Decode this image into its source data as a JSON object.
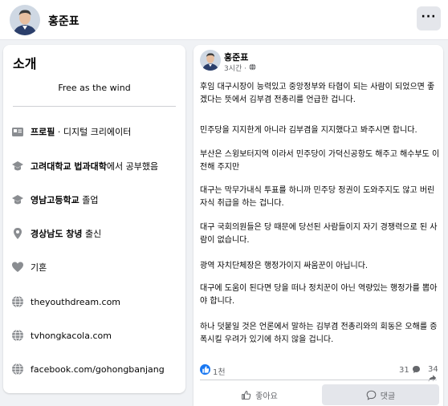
{
  "header": {
    "profile_name": "홍준표",
    "more_label": "···"
  },
  "intro": {
    "title": "소개",
    "bio": "Free as the wind",
    "items": [
      {
        "icon": "profile-card-icon",
        "bold": "프로필",
        "text": " · 디지털 크리에이터"
      },
      {
        "icon": "graduation-cap-icon",
        "bold": "고려대학교 법과대학",
        "text": "에서 공부했음"
      },
      {
        "icon": "graduation-cap-icon",
        "bold": "영남고등학교",
        "text": " 졸업"
      },
      {
        "icon": "location-pin-icon",
        "bold": "경상남도 창녕",
        "text": " 출신"
      },
      {
        "icon": "heart-icon",
        "bold": "",
        "text": "기혼"
      },
      {
        "icon": "globe-icon",
        "bold": "",
        "text": "theyouthdream.com"
      },
      {
        "icon": "globe-icon",
        "bold": "",
        "text": "tvhongkacola.com"
      },
      {
        "icon": "globe-icon",
        "bold": "",
        "text": "facebook.com/gohongbanjang"
      }
    ]
  },
  "post": {
    "author": "홍준표",
    "time": "3시간 ·",
    "paragraphs": [
      "후임 대구시장이 능력있고 중앙정부와 타협이 되는 사람이 되었으면 좋겠다는 뜻에서 김부겸 전총리를 언급한 겁니다.",
      "민주당을 지지한게 아니라 김부겸을 지지했다고 봐주시면 합니다.",
      "부산은 스윙보터지역 이라서 민주당이 가덕신공항도 해주고 해수부도 이전해 주지만",
      "대구는 막무가내식 투표를 하니까 민주당 정권이 도와주지도 않고 버린 자식 취급을 하는 겁니다.",
      "대구 국회의원들은 당 때문에 당선된 사람들이지 자기 경쟁력으로 된 사람이 없습니다.",
      "광역 자치단체장은 행정가이지 싸움꾼이 아닙니다.",
      "대구에 도움이 된다면 당을 떠나 정치꾼이 아닌 역량있는 행정가를 뽑아야 합니다.",
      "하나 덧붙일 것은 언론에서 말하는 김부겸 전총리와의 회동은 오해를 증폭시킬 우려가 있기에 하지 않을 겁니다."
    ],
    "reactions_count": "1천",
    "comments_count": "31",
    "shares_count": "34",
    "like_label": "좋아요",
    "comment_label": "댓글"
  },
  "colors": {
    "accent": "#1877f2",
    "background": "#f0f2f5",
    "muted_text": "#65676b"
  }
}
